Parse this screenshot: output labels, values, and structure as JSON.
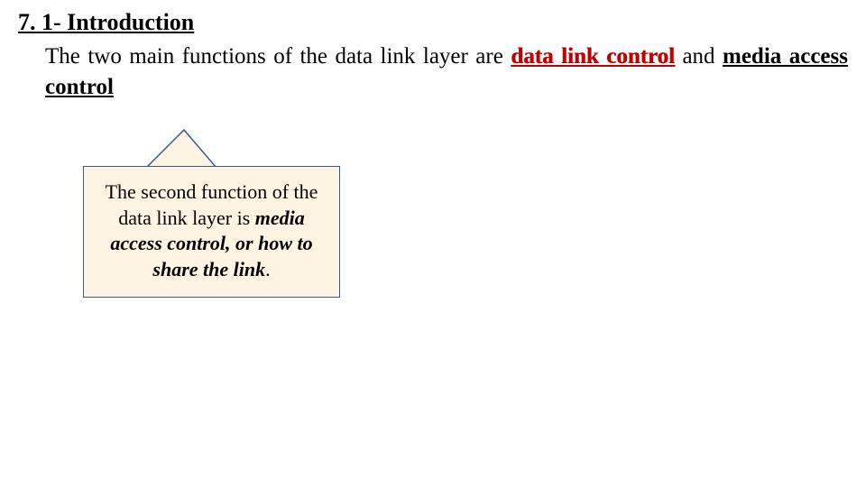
{
  "heading": "7. 1- Introduction",
  "intro": {
    "pre": "The two main functions of the data link layer are ",
    "emph1": "data link control",
    "mid": " and ",
    "emph2": "media access control"
  },
  "callout": {
    "line1": "The second function of the data link layer is ",
    "emph": "media access control, or how to share the link",
    "tail": "."
  },
  "colors": {
    "accent_red": "#c00000",
    "box_border": "#385d8a",
    "box_fill": "#fdf4e3"
  }
}
